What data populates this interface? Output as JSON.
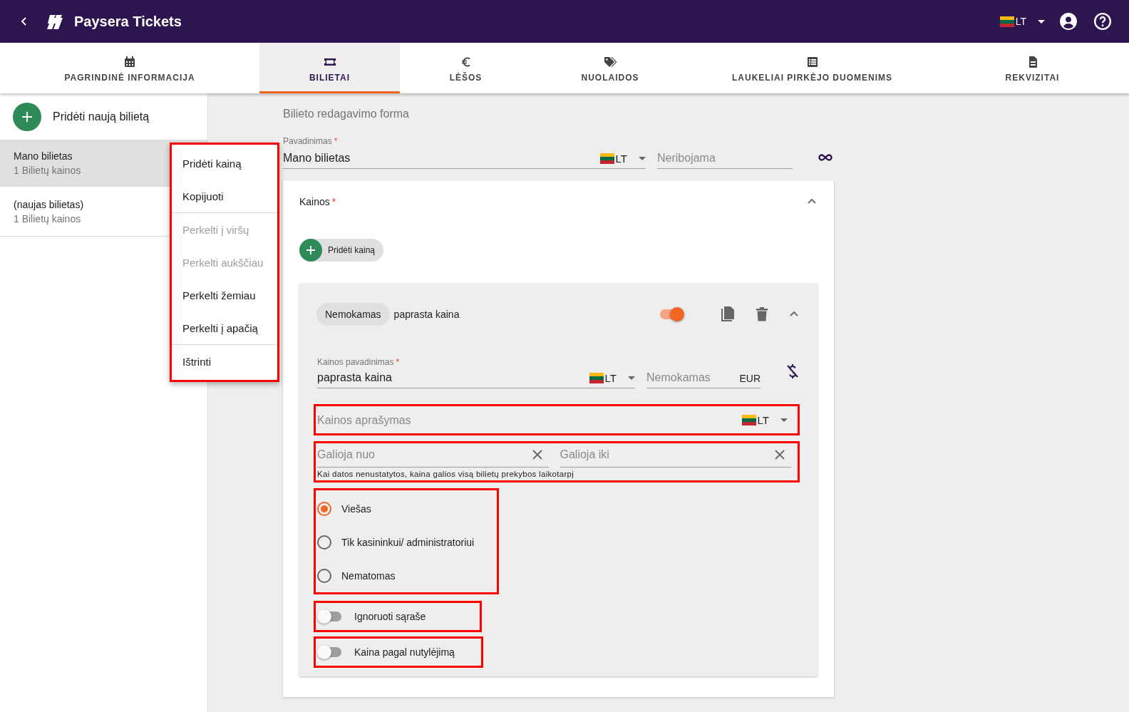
{
  "app_bar": {
    "title": "Paysera Tickets",
    "language": "LT"
  },
  "tabs": [
    {
      "label": "PAGRINDINĖ INFORMACIJA",
      "selected": false
    },
    {
      "label": "BILIETAI",
      "selected": true
    },
    {
      "label": "LĖŠOS",
      "selected": false
    },
    {
      "label": "NUOLAIDOS",
      "selected": false
    },
    {
      "label": "LAUKELIAI PIRKĖJO DUOMENIMS",
      "selected": false
    },
    {
      "label": "REKVIZITAI",
      "selected": false
    }
  ],
  "sidebar": {
    "add_button": "Pridėti naują bilietą",
    "tickets": [
      {
        "name": "Mano bilietas",
        "subtitle": "1 Bilietų kainos",
        "selected": true
      },
      {
        "name": "(naujas bilietas)",
        "subtitle": "1 Bilietų kainos",
        "selected": false
      }
    ]
  },
  "context_menu": {
    "highlighted": true,
    "items": [
      {
        "label": "Pridėti kainą",
        "disabled": false,
        "divider_after": false
      },
      {
        "label": "Kopijuoti",
        "disabled": false,
        "divider_after": true
      },
      {
        "label": "Perkelti į viršų",
        "disabled": true,
        "divider_after": false
      },
      {
        "label": "Perkelti aukščiau",
        "disabled": true,
        "divider_after": false
      },
      {
        "label": "Perkelti žemiau",
        "disabled": false,
        "divider_after": false
      },
      {
        "label": "Perkelti į apačią",
        "disabled": false,
        "divider_after": true
      },
      {
        "label": "Ištrinti",
        "disabled": false,
        "divider_after": false
      }
    ]
  },
  "form": {
    "heading": "Bilieto redagavimo forma",
    "name_field": {
      "label": "Pavadinimas",
      "required_mark": "*",
      "value": "Mano bilietas",
      "language": "LT"
    },
    "limit_field": {
      "placeholder": "Neribojama"
    },
    "prices_panel": {
      "title": "Kainos",
      "required_mark": "*",
      "expanded": true,
      "add_button": "Pridėti kainą",
      "price": {
        "chip": "Nemokamas",
        "name": "paprasta kaina",
        "enabled": true,
        "expanded": true,
        "name_field": {
          "label": "Kainos pavadinimas",
          "required_mark": "*",
          "value": "paprasta kaina",
          "language": "LT"
        },
        "amount_field": {
          "placeholder": "Nemokamas",
          "currency": "EUR"
        },
        "description_field": {
          "placeholder": "Kainos aprašymas",
          "language": "LT",
          "highlighted": true
        },
        "dates": {
          "highlighted": true,
          "from": {
            "placeholder": "Galioja nuo"
          },
          "to": {
            "placeholder": "Galioja iki"
          },
          "hint": "Kai datos nenustatytos, kaina galios visą bilietų prekybos laikotarpį"
        },
        "visibility": {
          "highlighted": true,
          "options": [
            {
              "label": "Viešas",
              "selected": true
            },
            {
              "label": "Tik kasininkui/ administratoriui",
              "selected": false
            },
            {
              "label": "Nematomas",
              "selected": false
            }
          ]
        },
        "switches": [
          {
            "label": "Ignoruoti sąraše",
            "on": false,
            "highlighted": true
          },
          {
            "label": "Kaina pagal nutylėjimą",
            "on": false,
            "highlighted": true
          }
        ]
      }
    }
  }
}
